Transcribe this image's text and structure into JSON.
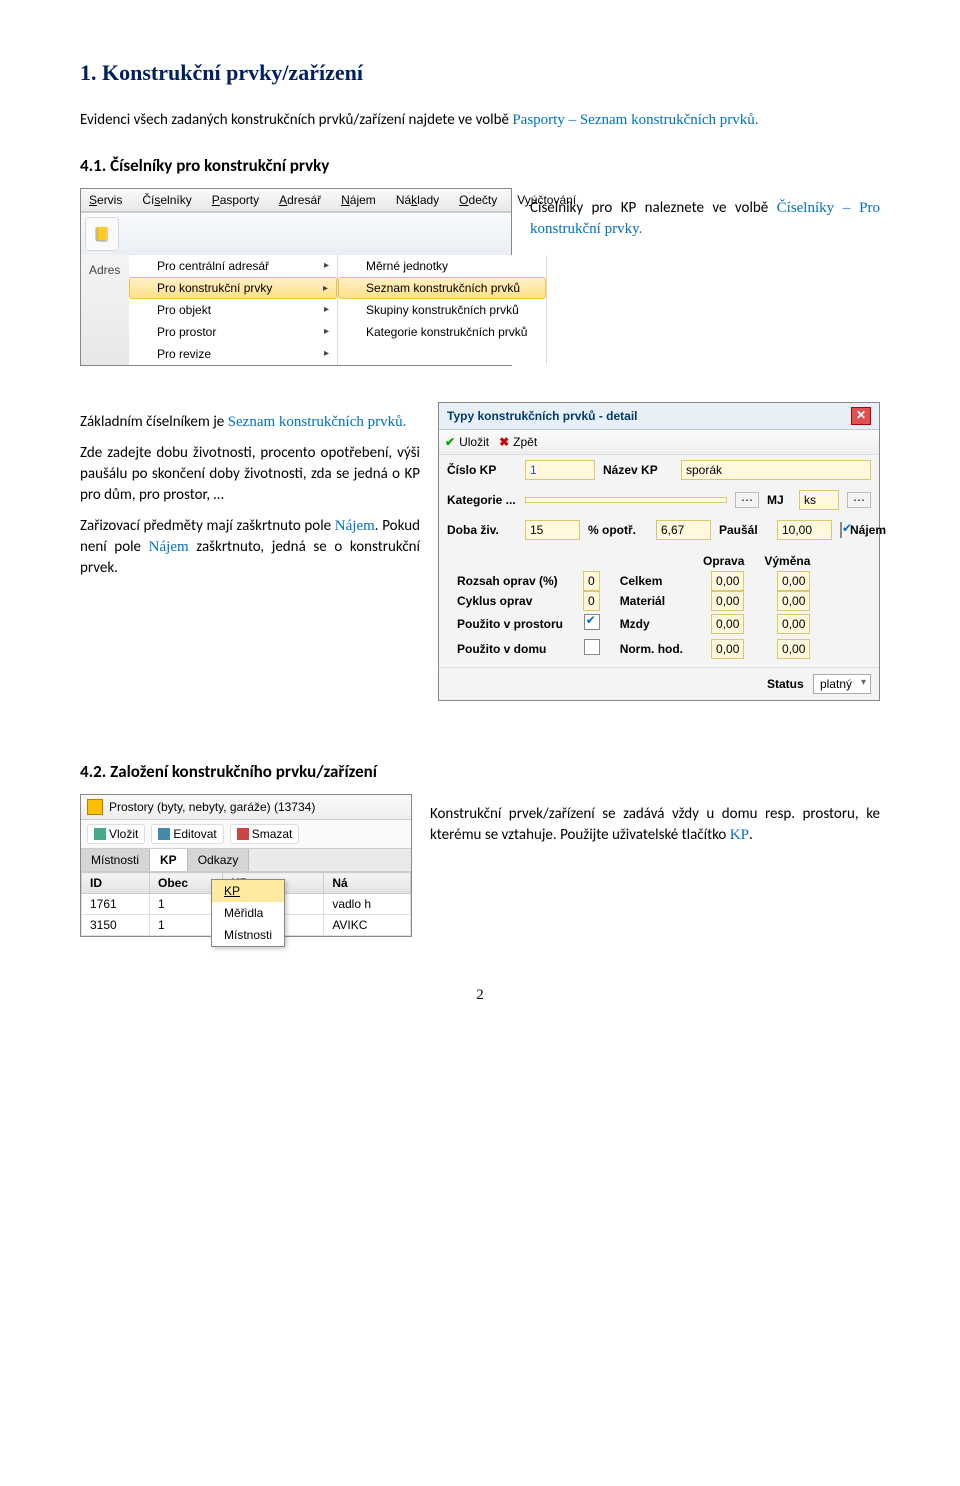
{
  "heading1": "1. Konstrukční prvky/zařízení",
  "intro_a": "Evidenci všech zadaných konstrukčních prvků/zařízení najdete ve volbě ",
  "intro_blue": "Pasporty – Seznam konstrukčních prvků.",
  "sec41": "4.1. Číselníky pro konstrukční prvky",
  "p41a": "Číselníky pro KP naleznete ve volbě ",
  "p41b": "Číselníky – Pro konstrukční prvky.",
  "p42a": "Základním číselníkem je ",
  "p42b": "Seznam konstrukčních prvků.",
  "p43": "Zde zadejte dobu životnosti, procento opotřebení, výši paušálu po skončení doby životnosti, zda se jedná o KP pro dům, pro prostor, …",
  "p44a": "Zařizovací předměty mají zaškrtnuto pole ",
  "p44b": "Nájem",
  "p44c": ". Pokud není pole ",
  "p44d": "Nájem",
  "p44e": " zaškrtnuto, jedná se o konstrukční prvek.",
  "sec42": "4.2. Založení konstrukčního prvku/zařízení",
  "p45": "Konstrukční prvek/zařízení se zadává vždy u domu resp. prostoru, ke kterému se vztahuje. Použijte uživatelské tlačítko ",
  "p45b": "KP",
  "p45c": ".",
  "menu": {
    "bar": [
      "Servis",
      "Číselníky",
      "Pasporty",
      "Adresář",
      "Nájem",
      "Náklady",
      "Odečty",
      "Vyúčtování"
    ],
    "col1": [
      "Pro centrální adresář",
      "Pro konstrukční prvky",
      "Pro objekt",
      "Pro prostor",
      "Pro revize"
    ],
    "col2": [
      "Měrné jednotky",
      "Seznam konstrukčních prvků",
      "Skupiny konstrukčních prvků",
      "Kategorie konstrukčních prvků"
    ],
    "sel1": 1,
    "sel2": 1,
    "adr": "Adres"
  },
  "dlg": {
    "title": "Typy konstrukčních prvků - detail",
    "save": "Uložit",
    "back": "Zpět",
    "cislo_l": "Číslo KP",
    "cislo_v": "1",
    "nazev_l": "Název KP",
    "nazev_v": "sporák",
    "kat_l": "Kategorie ...",
    "mj_l": "MJ",
    "mj_v": "ks",
    "doba_l": "Doba živ.",
    "doba_v": "15",
    "opotr_l": "% opotř.",
    "opotr_v": "6,67",
    "paus_l": "Paušál",
    "paus_v": "10,00",
    "najem_l": "Nájem",
    "th1": "Oprava",
    "th2": "Výměna",
    "rows": [
      {
        "l": "Rozsah oprav (%)",
        "v": "0",
        "cl": "Celkem",
        "a": "0,00",
        "b": "0,00"
      },
      {
        "l": "Cyklus oprav",
        "v": "0",
        "cl": "Materiál",
        "a": "0,00",
        "b": "0,00"
      },
      {
        "l": "Použito v prostoru",
        "v": "ck",
        "cl": "Mzdy",
        "a": "0,00",
        "b": "0,00"
      },
      {
        "l": "Použito v domu",
        "v": "",
        "cl": "Norm. hod.",
        "a": "0,00",
        "b": "0,00"
      }
    ],
    "status_l": "Status",
    "status_v": "platný"
  },
  "grid": {
    "title": "Prostory (byty, nebyty, garáže) (13734)",
    "btns": [
      "Vložit",
      "Editovat",
      "Smazat"
    ],
    "tabs": [
      "Místnosti",
      "KP",
      "Odkazy"
    ],
    "act_tab": 1,
    "headers": [
      "ID",
      "Obec",
      "KP",
      "Ná"
    ],
    "rows": [
      [
        "1761",
        "1",
        "Měřidla",
        "vadlo h"
      ],
      [
        "3150",
        "1",
        "Místnosti",
        "AVIKC"
      ]
    ],
    "pop": [
      "KP",
      "Měřidla",
      "Místnosti"
    ]
  },
  "pagenum": "2"
}
